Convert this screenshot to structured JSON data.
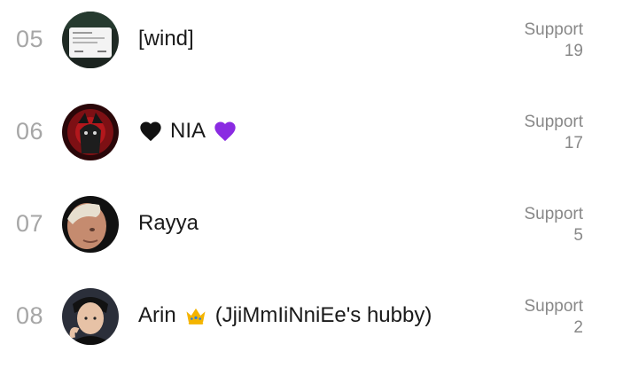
{
  "ranking": {
    "rows": [
      {
        "rank": "05",
        "name": "[wind]",
        "support_label": "Support",
        "support_count": "19"
      },
      {
        "rank": "06",
        "name_parts": [
          "NIA"
        ],
        "support_label": "Support",
        "support_count": "17"
      },
      {
        "rank": "07",
        "name": "Rayya",
        "support_label": "Support",
        "support_count": "5"
      },
      {
        "rank": "08",
        "name_parts": [
          "Arin",
          "(JjiMmIiNniEe's hubby)"
        ],
        "support_label": "Support",
        "support_count": "2"
      }
    ]
  },
  "icons": {
    "row_06_left_emoji": "black-heart-icon",
    "row_06_right_emoji": "purple-heart-icon",
    "row_08_emoji": "crown-icon"
  },
  "colors": {
    "rank": "#a6a6a6",
    "name": "#1a1a1a",
    "support": "#888888",
    "background": "#ffffff"
  }
}
